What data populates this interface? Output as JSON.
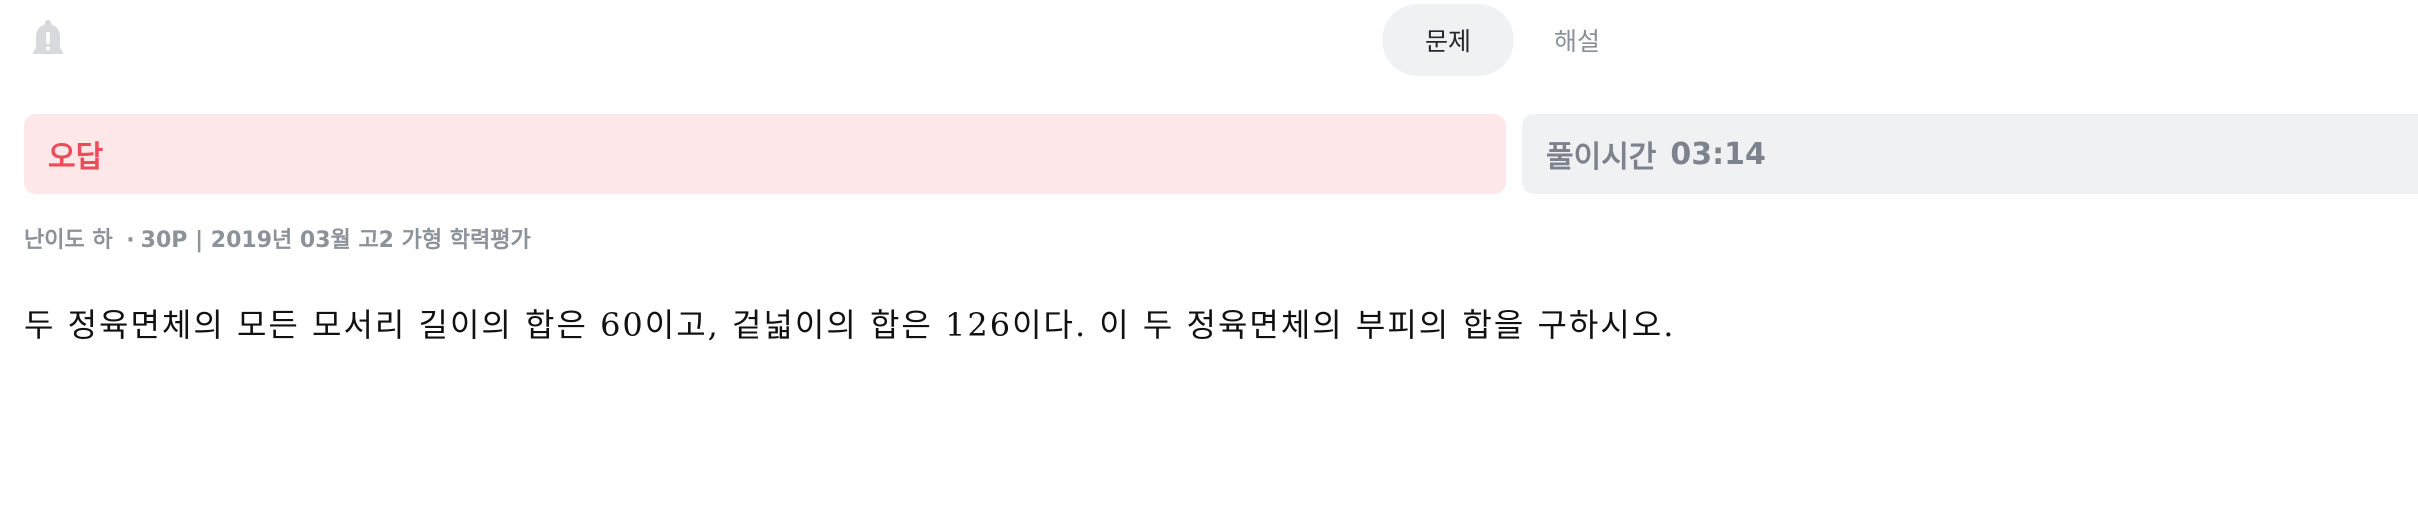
{
  "header": {
    "bell_icon": "bell-icon",
    "tabs": [
      {
        "label": "문제",
        "active": true
      },
      {
        "label": "해설",
        "active": false
      }
    ]
  },
  "status": {
    "result_label": "오답",
    "result_color": "#ef4a5a",
    "time_label": "풀이시간",
    "time_value": "03:14"
  },
  "meta": {
    "difficulty": "난이도 하",
    "separator_dot": "·",
    "points": "30P",
    "separator_bar": "|",
    "source": "2019년 03월 고2 가형 학력평가"
  },
  "question": {
    "text": "두 정육면체의 모든 모서리 길이의 합은 60이고, 겉넓이의 합은 126이다. 이 두 정육면체의 부피의 합을 구하시오."
  }
}
